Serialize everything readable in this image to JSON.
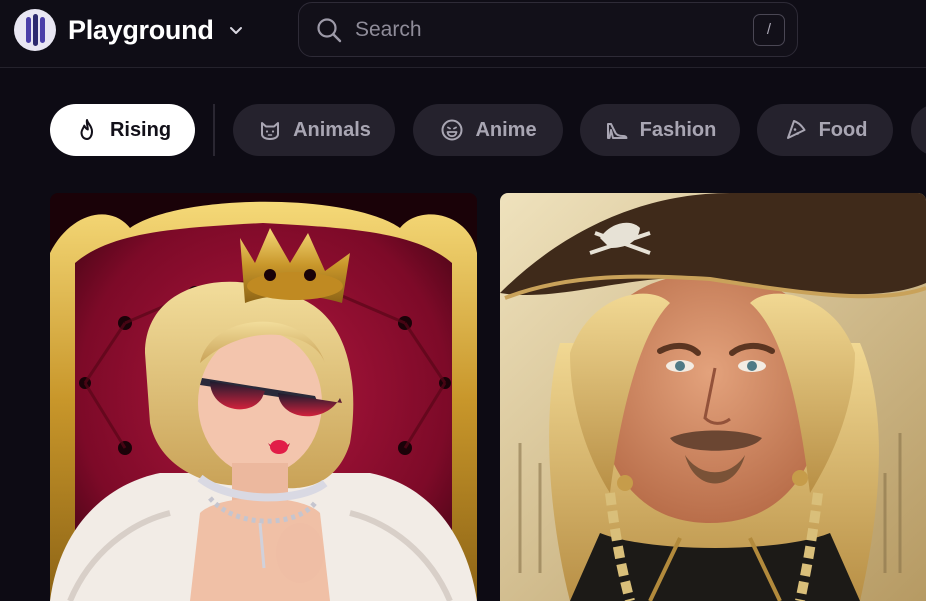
{
  "app": {
    "name": "Playground"
  },
  "search": {
    "placeholder": "Search",
    "shortcut": "/"
  },
  "categories": [
    {
      "label": "Rising",
      "icon": "flame-icon",
      "active": true
    },
    {
      "label": "Animals",
      "icon": "cat-icon",
      "active": false
    },
    {
      "label": "Anime",
      "icon": "smiley-icon",
      "active": false
    },
    {
      "label": "Fashion",
      "icon": "high-heel-icon",
      "active": false
    },
    {
      "label": "Food",
      "icon": "pizza-icon",
      "active": false
    }
  ],
  "gallery": [
    {
      "subject": "blonde woman with crown and red sunglasses on red throne"
    },
    {
      "subject": "blonde pirate man with tricorn hat"
    }
  ],
  "colors": {
    "background": "#0d0b14",
    "chip": "#25222d",
    "chip_active": "#ffffff"
  }
}
